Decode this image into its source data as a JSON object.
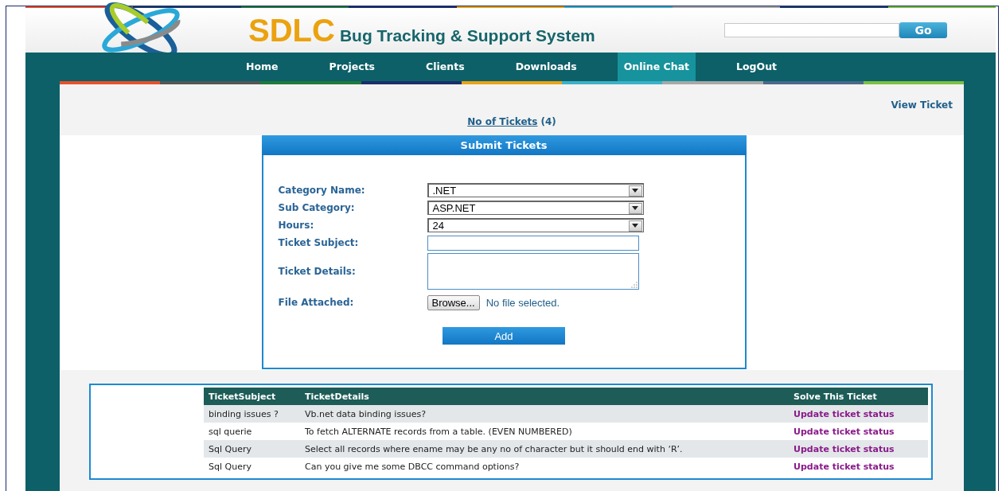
{
  "header": {
    "logo_title": "SDLC",
    "subtitle": "Bug Tracking & Support System",
    "search": {
      "button": "Go"
    }
  },
  "nav": [
    {
      "label": "Home",
      "selected": false
    },
    {
      "label": "Projects",
      "selected": false
    },
    {
      "label": "Clients",
      "selected": false
    },
    {
      "label": "Downloads",
      "selected": false
    },
    {
      "label": "Online Chat",
      "selected": true
    },
    {
      "label": "LogOut",
      "selected": false
    }
  ],
  "view_ticket_link": "View Ticket",
  "ticket_count": {
    "link": "No of Tickets",
    "count": "(4)"
  },
  "form": {
    "title": "Submit Tickets",
    "fields": [
      {
        "kind": "select",
        "label": "Category Name:",
        "value": ".NET"
      },
      {
        "kind": "select",
        "label": "Sub Category:",
        "value": "ASP.NET"
      },
      {
        "kind": "select",
        "label": "Hours:",
        "value": "24"
      },
      {
        "kind": "text",
        "label": "Ticket Subject:"
      },
      {
        "kind": "textarea",
        "label": "Ticket Details:"
      },
      {
        "kind": "file",
        "label": "File Attached:",
        "button": "Browse...",
        "status": "No file selected."
      }
    ],
    "submit": "Add"
  },
  "table": {
    "columns": [
      "TicketSubject",
      "TicketDetails",
      "Solve This Ticket"
    ],
    "rows": [
      {
        "subject": "binding issues ?",
        "details": "Vb.net data binding issues?",
        "action": "Update ticket status"
      },
      {
        "subject": "sql querie",
        "details": "To fetch ALTERNATE records from a table. (EVEN NUMBERED)",
        "action": "Update ticket status"
      },
      {
        "subject": "Sql Query",
        "details": "Select all records where ename may be any no of character but it should end with ‘R’.",
        "action": "Update ticket status"
      },
      {
        "subject": "Sql Query",
        "details": "Can you give me some DBCC command options?",
        "action": "Update ticket status"
      }
    ]
  }
}
